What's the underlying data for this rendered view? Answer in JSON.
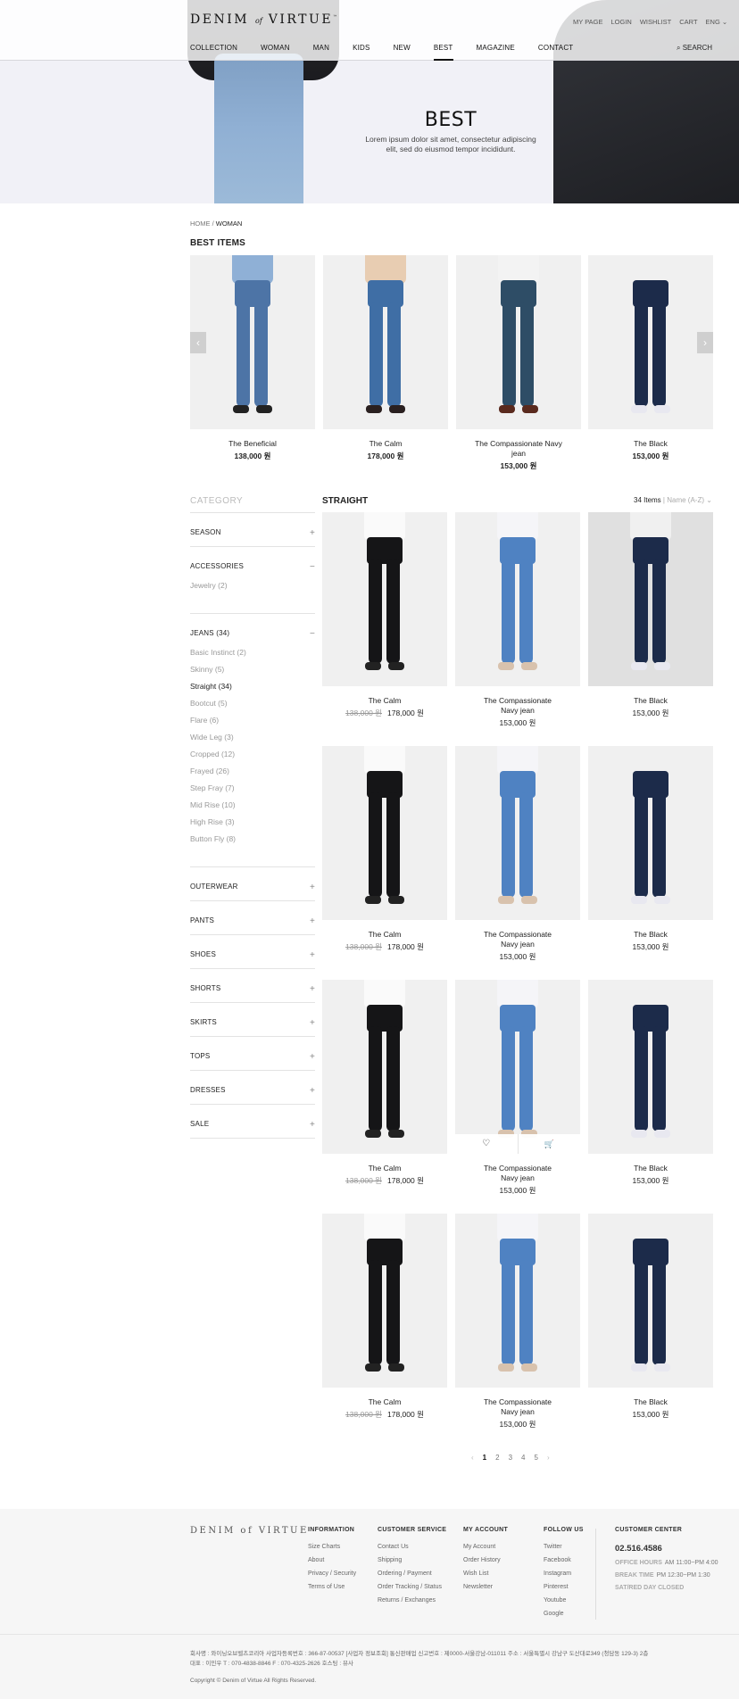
{
  "brand": {
    "logo_left": "DENIM",
    "logo_of": "of",
    "logo_right": "VIRTUE"
  },
  "top_links": [
    "MY PAGE",
    "LOGIN",
    "WISHLIST",
    "CART",
    "ENG ⌄"
  ],
  "nav": [
    "COLLECTION",
    "WOMAN",
    "MAN",
    "KIDS",
    "NEW",
    "BEST",
    "MAGAZINE",
    "CONTACT"
  ],
  "nav_active": "BEST",
  "search_label": "⌕ SEARCH",
  "hero": {
    "title": "BEST",
    "description": "Lorem ipsum dolor sit amet, consectetur adipiscing elit, sed do eiusmod tempor incididunt."
  },
  "breadcrumb": {
    "home": "HOME /",
    "current": "WOMAN"
  },
  "best": {
    "title": "BEST ITEMS",
    "items": [
      {
        "name": "The Beneficial",
        "price": "138,000 원",
        "style": "light"
      },
      {
        "name": "The Calm",
        "price": "178,000 원",
        "style": "mid"
      },
      {
        "name": "The Compassionate Navy jean",
        "price": "153,000 원",
        "style": "flare"
      },
      {
        "name": "The Black",
        "price": "153,000 원",
        "style": "navy"
      }
    ],
    "prev_icon": "chevron-left-icon",
    "next_icon": "chevron-right-icon"
  },
  "sidebar": {
    "title": "CATEGORY",
    "sections": [
      {
        "label": "SEASON",
        "toggle": "+"
      },
      {
        "label": "ACCESSORIES",
        "toggle": "−",
        "items": [
          {
            "label": "Jewelry  (2)"
          }
        ]
      },
      {
        "label": "JEANS (34)",
        "toggle": "−",
        "items": [
          {
            "label": "Basic Instinct (2)"
          },
          {
            "label": "Skinny (5)"
          },
          {
            "label": "Straight (34)",
            "selected": true
          },
          {
            "label": "Bootcut (5)"
          },
          {
            "label": "Flare (6)"
          },
          {
            "label": "Wide Leg (3)"
          },
          {
            "label": "Cropped  (12)"
          },
          {
            "label": "Frayed (26)"
          },
          {
            "label": "Step Fray (7)"
          },
          {
            "label": "Mid Rise (10)"
          },
          {
            "label": "High Rise (3)"
          },
          {
            "label": "Button Fly (8)"
          }
        ]
      },
      {
        "label": "OUTERWEAR",
        "toggle": "+"
      },
      {
        "label": "PANTS",
        "toggle": "+"
      },
      {
        "label": "SHOES",
        "toggle": "+"
      },
      {
        "label": "SHORTS",
        "toggle": "+"
      },
      {
        "label": "SKIRTS",
        "toggle": "+"
      },
      {
        "label": "TOPS",
        "toggle": "+"
      },
      {
        "label": "DRESSES",
        "toggle": "+"
      },
      {
        "label": "SALE",
        "toggle": "+"
      }
    ]
  },
  "listing": {
    "title": "STRAIGHT",
    "count": "34 Items",
    "sort": "Name (A-Z) ⌄",
    "products": [
      {
        "name": "The Calm",
        "old_price": "138,000 원",
        "price": "178,000 원",
        "style": "black"
      },
      {
        "name": "The Compassionate Navy jean",
        "price": "153,000 원",
        "style": "blue"
      },
      {
        "name": "The Black",
        "price": "153,000 원",
        "style": "navy"
      },
      {
        "name": "The Calm",
        "old_price": "138,000 원",
        "price": "178,000 원",
        "style": "black"
      },
      {
        "name": "The Compassionate Navy jean",
        "price": "153,000 원",
        "style": "blue"
      },
      {
        "name": "The Black",
        "price": "153,000 원",
        "style": "navy"
      },
      {
        "name": "The Calm",
        "old_price": "138,000 원",
        "price": "178,000 원",
        "style": "black"
      },
      {
        "name": "The Compassionate Navy jean",
        "price": "153,000 원",
        "style": "blue",
        "hover": true
      },
      {
        "name": "The Black",
        "price": "153,000 원",
        "style": "navy"
      },
      {
        "name": "The Calm",
        "old_price": "138,000 원",
        "price": "178,000 원",
        "style": "black"
      },
      {
        "name": "The Compassionate Navy jean",
        "price": "153,000 원",
        "style": "blue"
      },
      {
        "name": "The Black",
        "price": "153,000 원",
        "style": "navy"
      }
    ],
    "hover_actions": {
      "wishlist_icon": "heart-icon",
      "cart_icon": "cart-icon"
    }
  },
  "pagination": {
    "prev": "‹",
    "pages": [
      "1",
      "2",
      "3",
      "4",
      "5"
    ],
    "current": "1",
    "next": "›"
  },
  "footer": {
    "logo": "DENIM of VIRTUE",
    "columns": [
      {
        "title": "INFORMATION",
        "links": [
          "Size Charts",
          "About",
          "Privacy / Security",
          "Terms of Use"
        ]
      },
      {
        "title": "CUSTOMER SERVICE",
        "links": [
          "Contact Us",
          "Shipping",
          "Ordering / Payment",
          "Order Tracking / Status",
          "Returns / Exchanges"
        ]
      },
      {
        "title": "MY ACCOUNT",
        "links": [
          "My Account",
          "Order History",
          "Wish List",
          "Newsletter"
        ]
      },
      {
        "title": "FOLLOW US",
        "links": [
          "Twitter",
          "Facebook",
          "Instagram",
          "Pinterest",
          "Youtube",
          "Google"
        ]
      }
    ],
    "customer_center": {
      "title": "CUSTOMER CENTER",
      "phone": "02.516.4586",
      "hours": [
        {
          "label": "OFFICE HOURS",
          "value": "AM 11:00~PM 4:00"
        },
        {
          "label": "BREAK TIME",
          "value": "PM 12:30~PM 1:30"
        },
        {
          "label": "SAT/RED DAY CLOSED",
          "value": ""
        }
      ]
    },
    "company_line1": "회사명 : 와이닝오브벨츠코리아   사업자등록번호 : 366-87-00537 [사업자 정보조회]  통신판매업 신고번호 : 제0000-서울강남-011011   주소 : 서울특별시 강남구 도산대로349 (청담동 129-3) 2층",
    "company_line2": "대표 : 이민우    T : 070-4838-8846     F : 070-4325-2626    호스팅 : 뷰사",
    "copyright": "Copyright © Denim of Virtue All Rights Reserved."
  }
}
